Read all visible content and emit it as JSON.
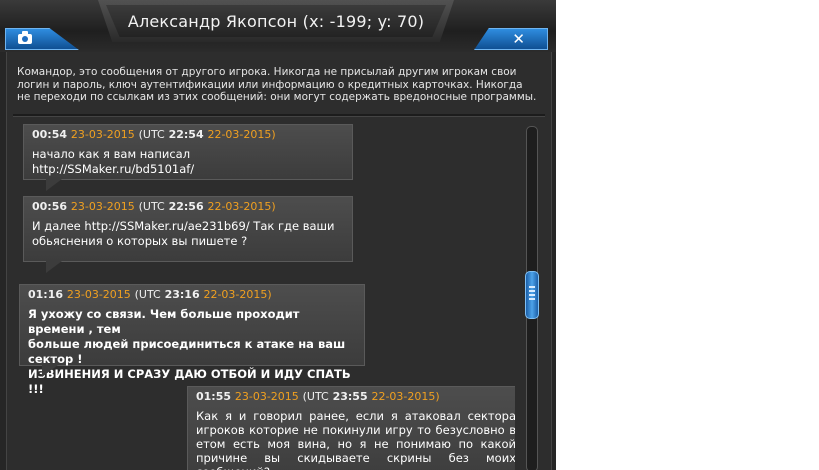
{
  "window": {
    "title": "Александр Якопсон (x: -199; y: 70)"
  },
  "icons": {
    "camera": "camera-icon",
    "close": "close-icon"
  },
  "close_label": "✕",
  "warning_text": "Командор, это сообщения от другого игрока. Никогда не присылай другим игрокам свои логин и пароль, ключ аутентификации или информацию о кредитных карточках. Никогда не переходи по ссылкам из этих сообщений: они могут содержать вредоносные программы.",
  "messages": [
    {
      "time": "00:54",
      "date": "23-03-2015",
      "utc_prefix": "(UTC",
      "utc_time": "22:54",
      "utc_date": "22-03-2015)",
      "lines": [
        "начало как я вам написал  http://SSMaker.ru/bd5101af/"
      ]
    },
    {
      "time": "00:56",
      "date": "23-03-2015",
      "utc_prefix": "(UTC",
      "utc_time": "22:56",
      "utc_date": "22-03-2015)",
      "lines": [
        "И далее http://SSMaker.ru/ae231b69/      Так где ваши",
        "обьяснения о которых вы пишете ?"
      ]
    },
    {
      "time": "01:16",
      "date": "23-03-2015",
      "utc_prefix": "(UTC",
      "utc_time": "23:16",
      "utc_date": "22-03-2015)",
      "lines": [
        "Я ухожу со связи. Чем больше проходит времени , тем",
        "больше людей присоединиться к атаке на ваш сектор !",
        "ИЗВИНЕНИЯ И СРАЗУ ДАЮ ОТБОЙ И ИДУ СПАТЬ !!!"
      ]
    },
    {
      "time": "01:55",
      "date": "23-03-2015",
      "utc_prefix": "(UTC",
      "utc_time": "23:55",
      "utc_date": "22-03-2015)",
      "lines": [
        "Как я и говорил ранее, если я атаковал сектора игроков которие не покинули игру то безусловно в етом есть моя вина, но я не понимаю по какой причине вы скидываете скрины без моих сообщений?"
      ]
    }
  ],
  "colors": {
    "accent_blue": "#1d6cbf",
    "date_orange": "#f0a020",
    "panel_bg": "#2d2d2d"
  }
}
